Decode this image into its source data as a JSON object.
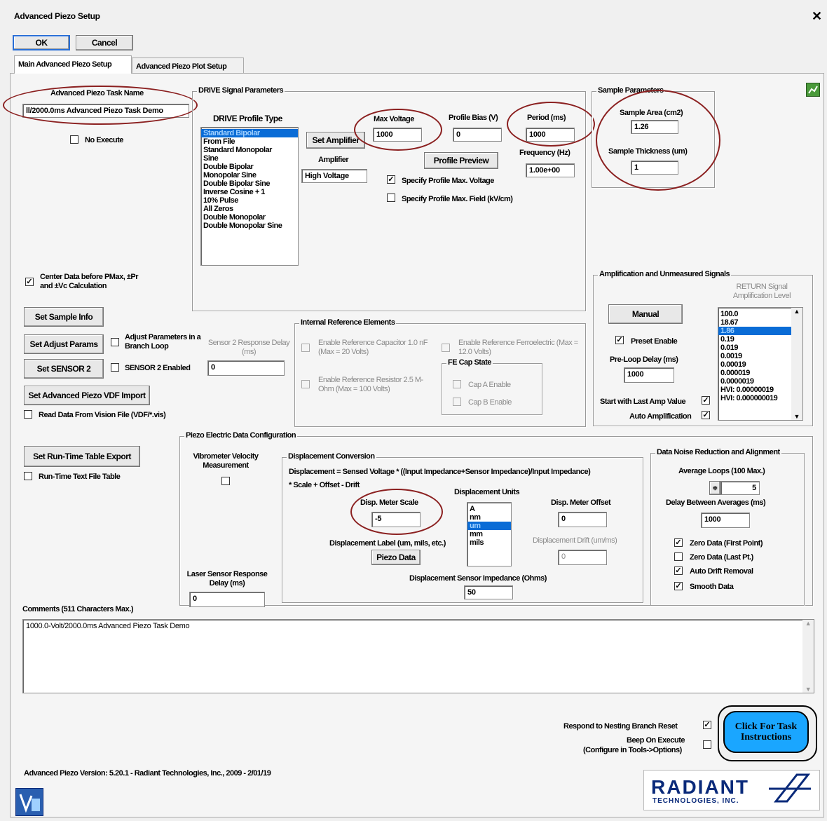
{
  "window": {
    "title": "Advanced Piezo Setup",
    "close": "✕"
  },
  "buttons": {
    "ok": "OK",
    "cancel": "Cancel",
    "set_amplifier": "Set Amplifier",
    "profile_preview": "Profile Preview",
    "manual": "Manual",
    "set_sample_info": "Set Sample Info",
    "set_adjust_params": "Set Adjust Params",
    "set_sensor2": "Set SENSOR 2",
    "set_vdf_import": "Set Advanced Piezo VDF Import",
    "set_runtime_export": "Set Run-Time Table Export",
    "piezo_data": "Piezo Data"
  },
  "tabs": [
    "Main Advanced Piezo Setup",
    "Advanced Piezo Plot Setup"
  ],
  "task": {
    "label": "Advanced Piezo Task Name",
    "value": "ll/2000.0ms Advanced Piezo Task Demo",
    "no_execute": "No Execute"
  },
  "drive": {
    "group": "DRIVE Signal Parameters",
    "profile_type_label": "DRIVE Profile Type",
    "profiles": [
      "Standard Bipolar",
      "From File",
      "Standard Monopolar",
      "Sine",
      "Double Bipolar",
      "Monopolar Sine",
      "Double Bipolar Sine",
      "Inverse Cosine + 1",
      "10% Pulse",
      "All Zeros",
      "Double Monopolar",
      "Double Monopolar Sine"
    ],
    "amplifier_label": "Amplifier",
    "amplifier_value": "High Voltage",
    "max_voltage_label": "Max Voltage",
    "max_voltage": "1000",
    "profile_bias_label": "Profile Bias (V)",
    "profile_bias": "0",
    "period_label": "Period (ms)",
    "period": "1000",
    "frequency_label": "Frequency (Hz)",
    "frequency": "1.00e+00",
    "specify_max_voltage": "Specify Profile Max. Voltage",
    "specify_max_field": "Specify Profile Max. Field (kV/cm)"
  },
  "sample": {
    "group": "Sample Parameters",
    "area_label": "Sample Area (cm2)",
    "area": "1.26",
    "thickness_label": "Sample Thickness (um)",
    "thickness": "1"
  },
  "center_data": "Center Data before PMax, ±Pr and ±Vc Calculation",
  "adjust_branch": "Adjust Parameters in a Branch Loop",
  "sensor2_enabled": "SENSOR 2 Enabled",
  "sensor2_delay_label": "Sensor 2 Response Delay (ms)",
  "sensor2_delay": "0",
  "read_vision": "Read Data From Vision File (VDF/*.vis)",
  "runtime_table": "Run-Time Text File Table",
  "internal_ref": {
    "group": "Internal Reference Elements",
    "cap": "Enable Reference Capacitor 1.0 nF (Max = 20 Volts)",
    "ferro": "Enable Reference Ferroelectric (Max = 12.0 Volts)",
    "resistor": "Enable Reference Resistor 2.5 M-Ohm (Max = 100 Volts)",
    "fe_cap_state": "FE Cap State",
    "cap_a": "Cap A Enable",
    "cap_b": "Cap B Enable"
  },
  "amp": {
    "group": "Amplification and Unmeasured Signals",
    "return_label": "RETURN Signal Amplification Level",
    "levels": [
      "100.0",
      "18.67",
      "1.86",
      "0.19",
      "0.019",
      "0.0019",
      "0.00019",
      "0.000019",
      "0.0000019",
      "HVI: 0.00000019",
      "HVI: 0.000000019"
    ],
    "preset_enable": "Preset Enable",
    "preloop_label": "Pre-Loop Delay (ms)",
    "preloop": "1000",
    "start_last": "Start with Last Amp Value",
    "auto_amp": "Auto Amplification"
  },
  "piezo": {
    "group": "Piezo Electric Data Configuration",
    "vibrometer": "Vibrometer Velocity Measurement",
    "laser_delay_label": "Laser Sensor Response Delay (ms)",
    "laser_delay": "0",
    "disp_group": "Displacement Conversion",
    "formula1": "Displacement = Sensed Voltage * ((Input Impedance+Sensor Impedance)/Input Impedance)",
    "formula2": "* Scale + Offset - Drift",
    "units_label": "Displacement Units",
    "units": [
      "A",
      "nm",
      "um",
      "mm",
      "mils"
    ],
    "scale_label": "Disp. Meter Scale",
    "scale": "-5",
    "offset_label": "Disp. Meter Offset",
    "offset": "0",
    "drift_label": "Displacement Drift (um/ms)",
    "drift": "0",
    "disp_label_label": "Displacement Label (um, mils, etc.)",
    "impedance_label": "Displacement Sensor Impedance (Ohms)",
    "impedance": "50"
  },
  "noise": {
    "group": "Data Noise Reduction and Alignment",
    "avg_label": "Average Loops (100 Max.)",
    "avg": "5",
    "delay_label": "Delay Between Averages (ms)",
    "delay": "1000",
    "zero_first": "Zero Data (First Point)",
    "zero_last": "Zero Data (Last Pt.)",
    "auto_drift": "Auto Drift Removal",
    "smooth": "Smooth Data"
  },
  "comments": {
    "label": "Comments (511 Characters Max.)",
    "value": "1000.0-Volt/2000.0ms Advanced Piezo Task Demo"
  },
  "footer": {
    "respond_nesting": "Respond to Nesting Branch Reset",
    "beep": "Beep On Execute",
    "beep2": "(Configure in Tools->Options)",
    "instructions": "Click For Task Instructions",
    "version": "Advanced Piezo Version: 5.20.1 - Radiant Technologies, Inc., 2009 - 2/01/19",
    "logo": "RADIANT",
    "logo_sub": "TECHNOLOGIES, INC."
  },
  "colors": {
    "oval": "#8b2020",
    "selection": "#0a6cd6",
    "instruction_btn": "#1aa6ff"
  }
}
